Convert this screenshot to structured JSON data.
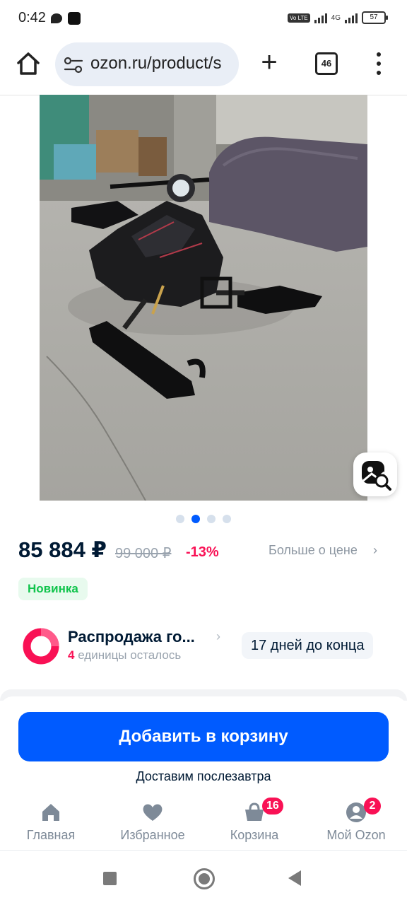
{
  "status_bar": {
    "time": "0:42",
    "volte": "Vo LTE",
    "network": "4G",
    "battery": "57"
  },
  "browser": {
    "url": "ozon.ru/product/s",
    "tab_count": "46"
  },
  "product": {
    "image_dots_total": 4,
    "image_dot_active": 2
  },
  "price": {
    "current": "85 884 ₽",
    "old": "99 000 ₽",
    "discount": "-13%",
    "more_label": "Больше о цене",
    "more_chevron": "›"
  },
  "badge": {
    "label": "Новинка"
  },
  "sale": {
    "title": "Распродажа го...",
    "chevron": "›",
    "count": "4",
    "remaining_label": " единицы осталось",
    "days_left": "17 дней до конца"
  },
  "actions": {
    "add_to_cart": "Добавить в корзину",
    "delivery": "Доставим послезавтра"
  },
  "bottom_nav": {
    "items": [
      {
        "label": "Главная",
        "icon": "home-icon"
      },
      {
        "label": "Избранное",
        "icon": "heart-icon"
      },
      {
        "label": "Корзина",
        "icon": "cart-icon",
        "badge": "16"
      },
      {
        "label": "Мой Ozon",
        "icon": "profile-icon",
        "badge": "2"
      }
    ]
  },
  "colors": {
    "primary": "#005bff",
    "sale_pink": "#f91155",
    "new_green": "#10c44c"
  }
}
